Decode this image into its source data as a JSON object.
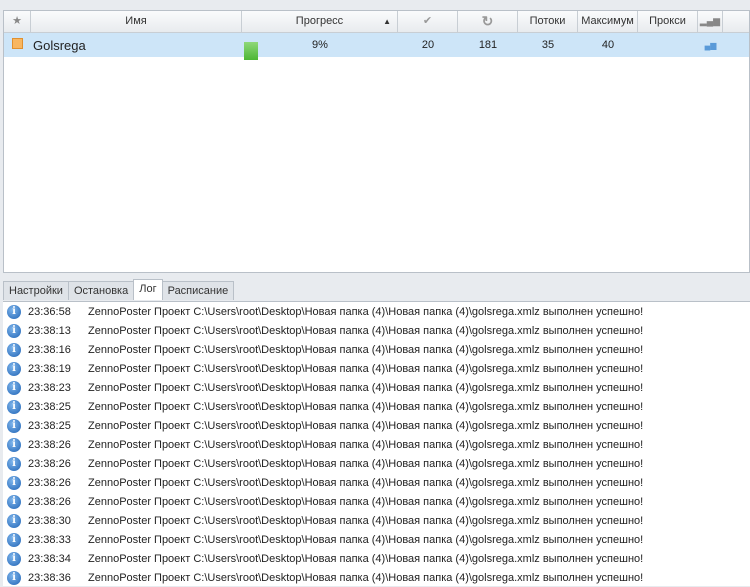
{
  "columns": {
    "name": "Имя",
    "progress": "Прогресс",
    "threads": "Потоки",
    "max": "Максимум",
    "proxy": "Прокси"
  },
  "task": {
    "name": "Golsrega",
    "progress_pct": 9,
    "progress": "9%",
    "success": "20",
    "attempts": "181",
    "threads": "35",
    "max": "40",
    "proxy": ""
  },
  "tabs": [
    "Настройки",
    "Остановка",
    "Лог",
    "Расписание"
  ],
  "active_tab": "Лог",
  "log": [
    {
      "time": "23:36:58",
      "msg": "ZennoPoster Проект C:\\Users\\root\\Desktop\\Новая папка (4)\\Новая папка (4)\\golsrega.xmlz выполнен успешно!"
    },
    {
      "time": "23:38:13",
      "msg": "ZennoPoster Проект C:\\Users\\root\\Desktop\\Новая папка (4)\\Новая папка (4)\\golsrega.xmlz выполнен успешно!"
    },
    {
      "time": "23:38:16",
      "msg": "ZennoPoster Проект C:\\Users\\root\\Desktop\\Новая папка (4)\\Новая папка (4)\\golsrega.xmlz выполнен успешно!"
    },
    {
      "time": "23:38:19",
      "msg": "ZennoPoster Проект C:\\Users\\root\\Desktop\\Новая папка (4)\\Новая папка (4)\\golsrega.xmlz выполнен успешно!"
    },
    {
      "time": "23:38:23",
      "msg": "ZennoPoster Проект C:\\Users\\root\\Desktop\\Новая папка (4)\\Новая папка (4)\\golsrega.xmlz выполнен успешно!"
    },
    {
      "time": "23:38:25",
      "msg": "ZennoPoster Проект C:\\Users\\root\\Desktop\\Новая папка (4)\\Новая папка (4)\\golsrega.xmlz выполнен успешно!"
    },
    {
      "time": "23:38:25",
      "msg": "ZennoPoster Проект C:\\Users\\root\\Desktop\\Новая папка (4)\\Новая папка (4)\\golsrega.xmlz выполнен успешно!"
    },
    {
      "time": "23:38:26",
      "msg": "ZennoPoster Проект C:\\Users\\root\\Desktop\\Новая папка (4)\\Новая папка (4)\\golsrega.xmlz выполнен успешно!"
    },
    {
      "time": "23:38:26",
      "msg": "ZennoPoster Проект C:\\Users\\root\\Desktop\\Новая папка (4)\\Новая папка (4)\\golsrega.xmlz выполнен успешно!"
    },
    {
      "time": "23:38:26",
      "msg": "ZennoPoster Проект C:\\Users\\root\\Desktop\\Новая папка (4)\\Новая папка (4)\\golsrega.xmlz выполнен успешно!"
    },
    {
      "time": "23:38:26",
      "msg": "ZennoPoster Проект C:\\Users\\root\\Desktop\\Новая папка (4)\\Новая папка (4)\\golsrega.xmlz выполнен успешно!"
    },
    {
      "time": "23:38:30",
      "msg": "ZennoPoster Проект C:\\Users\\root\\Desktop\\Новая папка (4)\\Новая папка (4)\\golsrega.xmlz выполнен успешно!"
    },
    {
      "time": "23:38:33",
      "msg": "ZennoPoster Проект C:\\Users\\root\\Desktop\\Новая папка (4)\\Новая папка (4)\\golsrega.xmlz выполнен успешно!"
    },
    {
      "time": "23:38:34",
      "msg": "ZennoPoster Проект C:\\Users\\root\\Desktop\\Новая папка (4)\\Новая папка (4)\\golsrega.xmlz выполнен успешно!"
    },
    {
      "time": "23:38:36",
      "msg": "ZennoPoster Проект C:\\Users\\root\\Desktop\\Новая папка (4)\\Новая папка (4)\\golsrega.xmlz выполнен успешно!"
    }
  ]
}
